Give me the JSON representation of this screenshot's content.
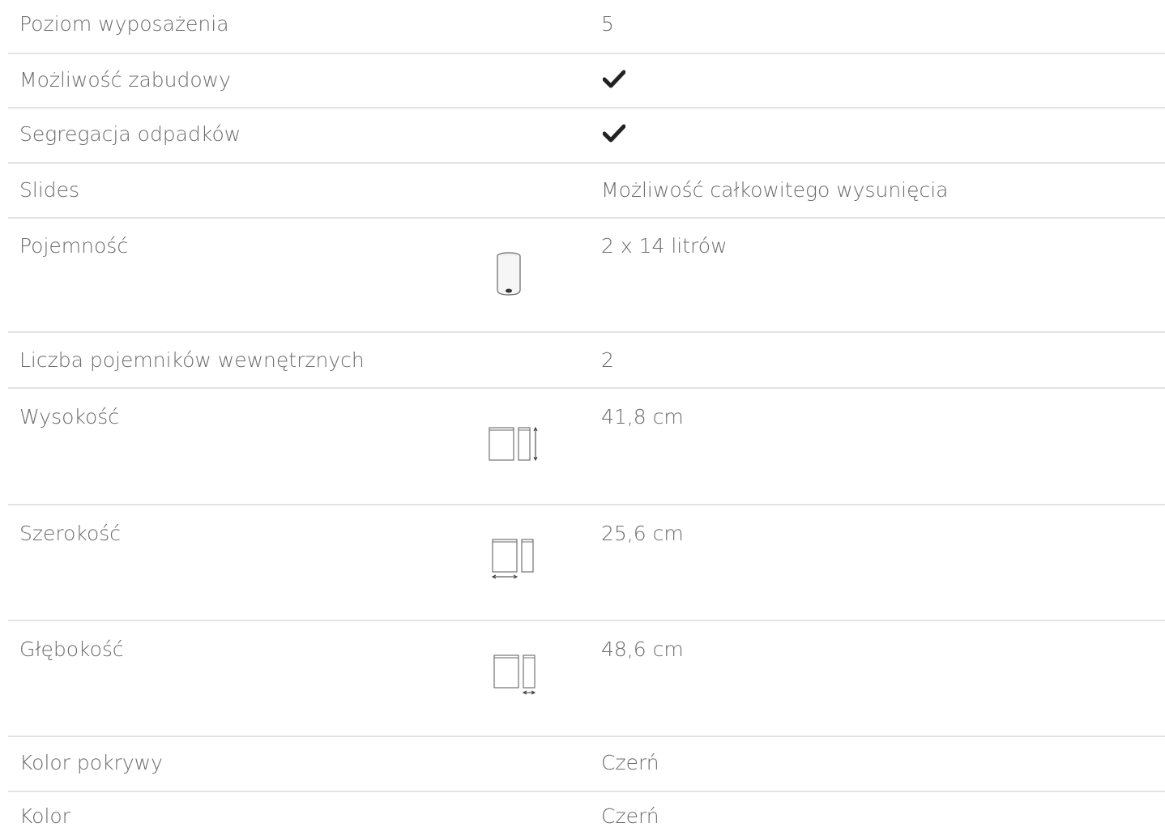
{
  "specs": [
    {
      "label": "Poziom wyposażenia",
      "value": "5"
    },
    {
      "label": "Możliwość zabudowy",
      "value": "",
      "icon": "check-icon"
    },
    {
      "label": "Segregacja odpadków",
      "value": "",
      "icon": "check-icon"
    },
    {
      "label": "Slides",
      "value": "Możliwość całkowitego wysunięcia"
    },
    {
      "label": "Pojemność",
      "value": "2 x 14 litrów",
      "icon": "bin-icon"
    },
    {
      "label": "Liczba pojemników wewnętrznych",
      "value": "2"
    },
    {
      "label": "Wysokość",
      "value": "41,8 cm",
      "icon": "height-dimension-icon"
    },
    {
      "label": "Szerokość",
      "value": "25,6 cm",
      "icon": "width-dimension-icon"
    },
    {
      "label": "Głębokość",
      "value": "48,6 cm",
      "icon": "depth-dimension-icon"
    },
    {
      "label": "Kolor pokrywy",
      "value": "Czerń"
    },
    {
      "label": "Kolor",
      "value": "Czerń"
    }
  ],
  "colors": {
    "text": "#6b6b6b",
    "divider": "#e3e3e3",
    "check": "#222222"
  }
}
